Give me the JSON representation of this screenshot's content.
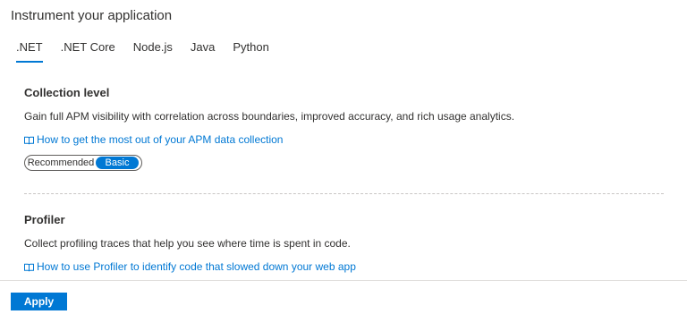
{
  "header": {
    "title": "Instrument your application"
  },
  "tabs": [
    {
      "label": ".NET",
      "active": true
    },
    {
      "label": ".NET Core",
      "active": false
    },
    {
      "label": "Node.js",
      "active": false
    },
    {
      "label": "Java",
      "active": false
    },
    {
      "label": "Python",
      "active": false
    }
  ],
  "collection": {
    "title": "Collection level",
    "description": "Gain full APM visibility with correlation across boundaries, improved accuracy, and rich usage analytics.",
    "link_text": "How to get the most out of your APM data collection",
    "link_icon": "book-icon",
    "toggle": {
      "options": [
        "Recommended",
        "Basic"
      ],
      "selected": "Basic"
    }
  },
  "profiler": {
    "title": "Profiler",
    "description": "Collect profiling traces that help you see where time is spent in code.",
    "link_text": "How to use Profiler to identify code that slowed down your web app",
    "link_icon": "book-icon"
  },
  "footer": {
    "apply_label": "Apply"
  },
  "colors": {
    "accent": "#0078d4",
    "text": "#323130",
    "divider": "#c8c6c4"
  }
}
